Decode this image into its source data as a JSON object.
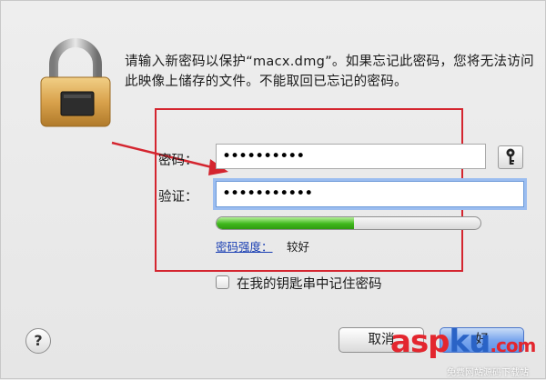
{
  "dialog": {
    "message": "请输入新密码以保护“macx.dmg”。如果忘记此密码，您将无法访问此映像上储存的文件。不能取回已忘记的密码。"
  },
  "form": {
    "password_label": "密码：",
    "password_value": "••••••••••",
    "verify_label": "验证：",
    "verify_value": "•••••••••••",
    "strength_link": "密码强度：",
    "strength_value": "较好",
    "strength_fraction": 0.52,
    "remember_label": "在我的钥匙串中记住密码",
    "remember_checked": false
  },
  "buttons": {
    "help": "?",
    "cancel": "取消",
    "ok": "好"
  },
  "watermark": {
    "brand_a": "asp",
    "brand_b": "ku",
    "brand_c": ".com",
    "sub": "免费网站源码下载站"
  },
  "colors": {
    "highlight_border": "#d4252f",
    "focus_ring": "#9bbdf0",
    "meter_green": "#3fb81c",
    "link_blue": "#1a3fb3"
  }
}
